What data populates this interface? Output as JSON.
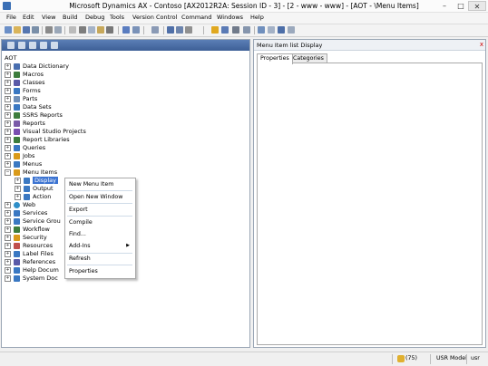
{
  "window": {
    "title": "Microsoft Dynamics AX - Contoso [AX2012R2A: Session ID - 3] - [2 - www - www] - [AOT - \\Menu Items]",
    "minimize_glyph": "–",
    "maximize_glyph": "□",
    "close_glyph": "✕"
  },
  "menubar": [
    "File",
    "Edit",
    "View",
    "Build",
    "Debug",
    "Tools",
    "Version Control",
    "Command",
    "Windows",
    "Help"
  ],
  "aot": {
    "root": "AOT",
    "nodes": [
      {
        "label": "Data Dictionary",
        "icon_color": "#4a6fb0"
      },
      {
        "label": "Macros",
        "icon_color": "#3d7d3d"
      },
      {
        "label": "Classes",
        "icon_color": "#5a5aa8"
      },
      {
        "label": "Forms",
        "icon_color": "#3a78c2"
      },
      {
        "label": "Parts",
        "icon_color": "#6f8fb8"
      },
      {
        "label": "Data Sets",
        "icon_color": "#3a78c2"
      },
      {
        "label": "SSRS Reports",
        "icon_color": "#3d7d3d"
      },
      {
        "label": "Reports",
        "icon_color": "#7a5aa8"
      },
      {
        "label": "Visual Studio Projects",
        "icon_color": "#7a4fb0"
      },
      {
        "label": "Report Libraries",
        "icon_color": "#3d7d3d"
      },
      {
        "label": "Queries",
        "icon_color": "#3a78c2"
      },
      {
        "label": "Jobs",
        "icon_color": "#d99a1a"
      },
      {
        "label": "Menus",
        "icon_color": "#3a78c2"
      },
      {
        "label": "Menu Items",
        "icon_color": "#d99a1a"
      },
      {
        "label": "Display",
        "icon_color": "#3a78c2"
      },
      {
        "label": "Output",
        "icon_color": "#3a78c2"
      },
      {
        "label": "Action",
        "icon_color": "#3a78c2"
      },
      {
        "label": "Web",
        "icon_color": "#2f8fc8"
      },
      {
        "label": "Services",
        "icon_color": "#3a78c2"
      },
      {
        "label": "Service Grou",
        "icon_color": "#3a78c2"
      },
      {
        "label": "Workflow",
        "icon_color": "#3d7d3d"
      },
      {
        "label": "Security",
        "icon_color": "#d99a1a"
      },
      {
        "label": "Resources",
        "icon_color": "#c0504d"
      },
      {
        "label": "Label Files",
        "icon_color": "#3a78c2"
      },
      {
        "label": "References",
        "icon_color": "#5a5aa8"
      },
      {
        "label": "Help Docum",
        "icon_color": "#3a78c2"
      },
      {
        "label": "System Doc",
        "icon_color": "#3a78c2"
      }
    ]
  },
  "context_menu": {
    "items": [
      "New Menu Item",
      "Open New Window",
      "Export",
      "Compile",
      "Find...",
      "Add-Ins",
      "Refresh",
      "Properties"
    ],
    "submenu_arrow": "▶"
  },
  "right_panel": {
    "title": "Menu Item list Display",
    "close_glyph": "x",
    "tabs": [
      "Properties",
      "Categories"
    ]
  },
  "status_bar": {
    "count": "(75)",
    "model": "USR Model",
    "user": "usr"
  },
  "colors": {
    "selection": "#3b73d1",
    "aot_toolbar": "#4a6da6"
  }
}
